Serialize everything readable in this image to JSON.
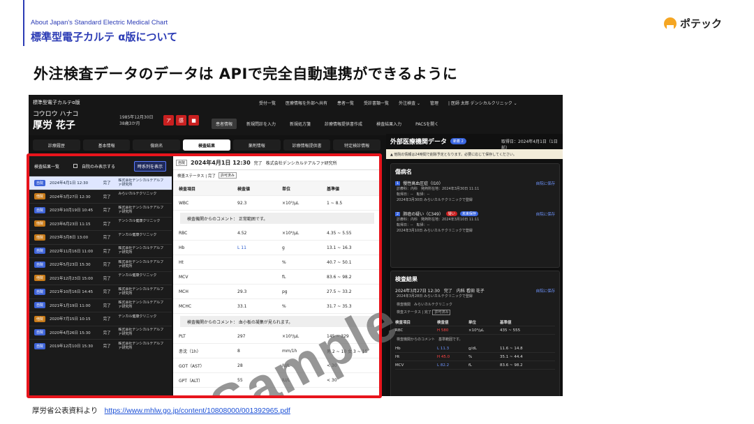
{
  "slide": {
    "subtitle_en": "About Japan's Standard Electric Medical Chart",
    "subtitle_jp": "標準型電子カルテ α版について",
    "logo_text": "ポテック",
    "headline": "外注検査データのデータは APIで完全自動連携ができるように",
    "watermark": "Sample",
    "footer_label": "厚労省公表資料より",
    "footer_link": "https://www.mhlw.go.jp/content/10808000/001392965.pdf",
    "accent_color": "#2b3bb5",
    "highlight_color": "#e8141c"
  },
  "app": {
    "name": "標準型電子カルテα版",
    "patient_kana": "コウロウ ハナコ",
    "patient_name": "厚労 花子",
    "dob": "1985年12月30日 38歳3か月",
    "flags": [
      "ア",
      "感",
      "■"
    ],
    "topnav": [
      "受付一覧",
      "医療情報を外部へ共有",
      "患者一覧",
      "受診書類一覧",
      "外注検査 ⌄",
      "管理",
      "| 医師 太郎 デンシカルクリニック ⌄"
    ],
    "subnav": [
      "患者情報",
      "新規問診を入力",
      "新規処方箋",
      "診療情報提供書作成",
      "検査結果入力",
      "PACSを開く"
    ],
    "tabs": [
      "診療履歴",
      "基本情報",
      "傷病名",
      "検査結果",
      "薬剤情報",
      "診療情報提供書",
      "特定検診情報"
    ],
    "active_tab": "検査結果"
  },
  "list": {
    "title": "検査結果一覧",
    "own_only": "自院のみ表示する",
    "timeline_button": "時系列を表示",
    "rows": [
      {
        "badge": "自院",
        "date": "2024年4月1日 12:30",
        "status": "完了",
        "org": "株式会社デンシカルテアルファ研究所"
      },
      {
        "badge": "他院",
        "date": "2024年3月27日 12:30",
        "status": "完了",
        "org": "みらいカルテクリニック"
      },
      {
        "badge": "自院",
        "date": "2023年10月19日 10:45",
        "status": "完了",
        "org": "株式会社デンシカルテアルファ研究所"
      },
      {
        "badge": "他院",
        "date": "2023年6月23日 11:15",
        "status": "完了",
        "org": "デンシカル健康クリニック"
      },
      {
        "badge": "他院",
        "date": "2023年3月8日 13:00",
        "status": "完了",
        "org": "デンカル健康クリニック"
      },
      {
        "badge": "自院",
        "date": "2022年11月16日 11:00",
        "status": "完了",
        "org": "株式会社デンシカルテアルファ研究所"
      },
      {
        "badge": "自院",
        "date": "2022年5月23日 15:30",
        "status": "完了",
        "org": "株式会社デンシカルテアルファ研究所"
      },
      {
        "badge": "他院",
        "date": "2021年12月23日 15:00",
        "status": "完了",
        "org": "デンカル健康クリニック"
      },
      {
        "badge": "自院",
        "date": "2021年10月16日 14:45",
        "status": "完了",
        "org": "株式会社デンシカルテアルファ研究所"
      },
      {
        "badge": "自院",
        "date": "2021年1月19日 11:00",
        "status": "完了",
        "org": "株式会社デンシカルテアルファ研究所"
      },
      {
        "badge": "他院",
        "date": "2020年7月15日 10:15",
        "status": "完了",
        "org": "デンカル健康クリニック"
      },
      {
        "badge": "自院",
        "date": "2020年4月26日 15:30",
        "status": "完了",
        "org": "株式会社デンシカルテアルファ研究所"
      },
      {
        "badge": "自院",
        "date": "2019年12月10日 15:30",
        "status": "完了",
        "org": "株式会社デンシカルテアルファ研究所"
      }
    ]
  },
  "detail": {
    "tag": "自院",
    "date": "2024年4月1日 12:30",
    "status": "完了",
    "org": "株式会社デンシカルテアルファ研究所",
    "exam_status": "検査ステータス | 完了",
    "exam_chip": "許可済み",
    "headers": [
      "検査項目",
      "検査値",
      "単位",
      "基準値"
    ],
    "rows_a": [
      {
        "item": "WBC",
        "value": "92.3",
        "unit": "×10³/μL",
        "ref": "1 ~ 8.5"
      }
    ],
    "comment1": "検査機関からのコメント： 正常範囲です。",
    "rows_b": [
      {
        "item": "RBC",
        "value": "4.52",
        "unit": "×10⁶/μL",
        "ref": "4.35 ~ 5.55"
      },
      {
        "item": "Hb",
        "value": "L 11",
        "unit": "g",
        "ref": "13.1 ~ 16.3"
      },
      {
        "item": "Ht",
        "value": "",
        "unit": "%",
        "ref": "40.7 ~ 50.1"
      },
      {
        "item": "MCV",
        "value": "",
        "unit": "fL",
        "ref": "83.6 ~ 98.2"
      },
      {
        "item": "MCH",
        "value": "29.3",
        "unit": "pg",
        "ref": "27.5 ~ 33.2"
      },
      {
        "item": "MCHC",
        "value": "33.1",
        "unit": "%",
        "ref": "31.7 ~ 35.3"
      }
    ],
    "comment2": "検査機関からのコメント： 血小板の凝集が見られます。",
    "rows_c": [
      {
        "item": "PLT",
        "value": "297",
        "unit": "×10³/μL",
        "ref": "145 ~ 329"
      },
      {
        "item": "赤沈（1h）",
        "value": "8",
        "unit": "mm/1h",
        "ref": "男 2 ~ 10 女 3 ~ 15"
      },
      {
        "item": "GOT（AST）",
        "value": "28",
        "unit": "IU/L",
        "ref": "< 30"
      },
      {
        "item": "GPT（ALT）",
        "value": "55",
        "unit": "IU/L",
        "ref": "< 30"
      }
    ]
  },
  "external": {
    "title": "外部医療機関データ",
    "new_badge": "新着 2",
    "fetched": "取得日：2024年4月1日（1日前）",
    "warning": "▲ 他院の情報は24時間で削除予定となります。必要に応じて保存してください。",
    "dx_title": "傷病名",
    "dx": [
      {
        "num": "1",
        "name": "慢性高血圧症（I10）",
        "line1": "診療科：内科　発熱所在地：2024年3月30日 11:11",
        "line2": "転帰日：--　転帰：--",
        "line3": "2024年3月30日 みらいカルテクリニックで登録",
        "save": "自院に保存",
        "pills": []
      },
      {
        "num": "2",
        "name": "肺癌の疑い（C349）",
        "line1": "診療科：内科　発熱所在地：2024年3月10日 11:11",
        "line2": "転帰日：--　転帰：--",
        "line3": "2024年3月10日 みらいカルテクリニックで登録",
        "save": "自院に保存",
        "pills": [
          "疑い",
          "未来保存"
        ]
      }
    ],
    "res_title": "検査結果",
    "res_date": "2024年3月27日 12:30　完了　内科 看田 花子",
    "res_reg": "2024年3月28日 みらいカルテクリニックで登録",
    "res_org": "検査機関　みらいカルテクリニック",
    "res_status": "検査ステータス | 完了",
    "res_chip": "許可済み",
    "res_save": "自院に保存",
    "res_headers": [
      "検査項目",
      "検査値",
      "単位",
      "基準値"
    ],
    "res_rows1": [
      {
        "item": "RBC",
        "flag": "H",
        "value": "580",
        "unit": "×10⁶/μL",
        "ref": "435 ~ 555",
        "cls": "red"
      }
    ],
    "res_comment": "検査機関からのコメント　基準範囲です。",
    "res_rows2": [
      {
        "item": "Hb",
        "flag": "L",
        "value": "11.3",
        "unit": "g/dL",
        "ref": "11.6 ~ 14.8",
        "cls": "blue"
      },
      {
        "item": "Ht",
        "flag": "H",
        "value": "45.0",
        "unit": "%",
        "ref": "35.1 ~ 44.4",
        "cls": "red"
      },
      {
        "item": "MCV",
        "flag": "L",
        "value": "82.2",
        "unit": "fL",
        "ref": "83.6 ~ 98.2",
        "cls": "blue"
      }
    ]
  }
}
